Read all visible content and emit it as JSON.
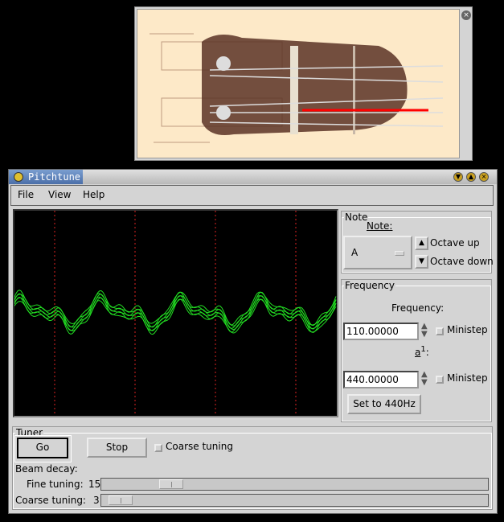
{
  "image_window": {
    "close_icon": "close-icon"
  },
  "window": {
    "title": "Pitchtune"
  },
  "menu": [
    "File",
    "View",
    "Help"
  ],
  "note": {
    "group": "Note",
    "label": "Note:",
    "value": "A",
    "octave_up": "Octave up",
    "octave_down": "Octave down"
  },
  "frequency": {
    "group": "Frequency",
    "label": "Frequency:",
    "value": "110.00000",
    "ministep": "Ministep",
    "a1_label": "a",
    "a1_sup": "1",
    "a1_colon": ":",
    "a1_value": "440.00000",
    "ministep2": "Ministep",
    "set440": "Set to 440Hz"
  },
  "tuner": {
    "group": "Tuner",
    "go": "Go",
    "stop": "Stop",
    "coarse_tuning_check": "Coarse tuning",
    "beam_decay": "Beam decay:",
    "fine_label": "Fine tuning:",
    "fine_value": "15",
    "fine_fraction": 0.16,
    "coarse_label": "Coarse tuning:",
    "coarse_value": "3",
    "coarse_fraction": 0.02
  },
  "colors": {
    "wave": "#22dd22",
    "grid": "#dd2222"
  }
}
